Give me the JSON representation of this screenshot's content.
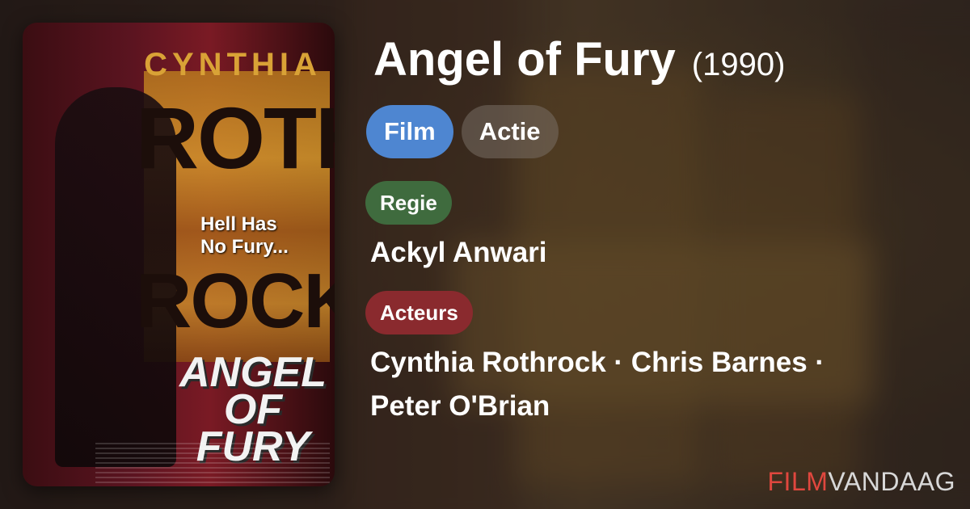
{
  "movie": {
    "title": "Angel of Fury",
    "year": "(1990)"
  },
  "tags": {
    "type": "Film",
    "genre": "Actie"
  },
  "director": {
    "label": "Regie",
    "name": "Ackyl Anwari"
  },
  "cast": {
    "label": "Acteurs",
    "line1": "Cynthia Rothrock · Chris Barnes ·",
    "line2": "Peter O'Brian"
  },
  "poster": {
    "top_name": "CYNTHIA",
    "name_part1": "ROTH",
    "name_part2": "ROCK",
    "tagline_1": "Hell Has",
    "tagline_2": "No Fury...",
    "title_1": "ANGEL",
    "title_2": "OF FURY"
  },
  "brand": {
    "part1": "FILM",
    "part2": "VANDAAG"
  },
  "colors": {
    "film_pill": "#4e86d1",
    "regie_label": "#3f6b3e",
    "acteurs_label": "#8a2a2e",
    "brand_red": "#e0473e"
  }
}
